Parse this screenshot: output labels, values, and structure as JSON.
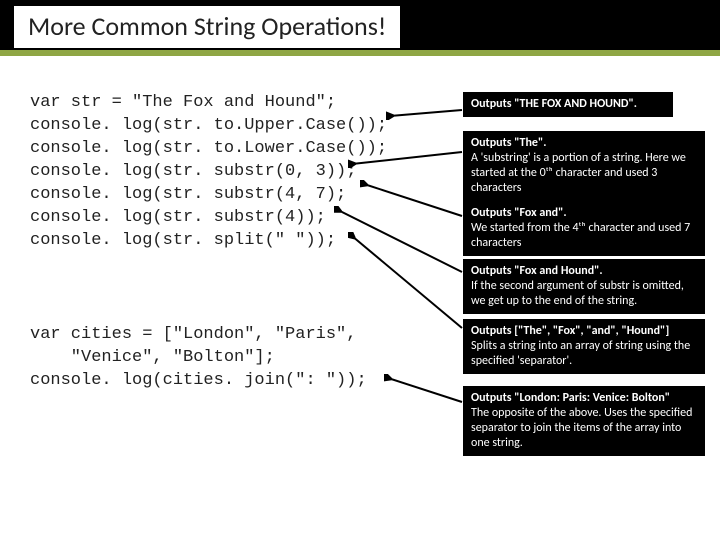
{
  "title": "More Common String Operations!",
  "code1": "var str = \"The Fox and Hound\";\nconsole. log(str. to.Upper.Case());\nconsole. log(str. to.Lower.Case());\nconsole. log(str. substr(0, 3));\nconsole. log(str. substr(4, 7);\nconsole. log(str. substr(4));\nconsole. log(str. split(\" \"));",
  "code2": "var cities = [\"London\", \"Paris\",\n    \"Venice\", \"Bolton\"];\nconsole. log(cities. join(\": \"));",
  "annos": {
    "a1": {
      "head": "Outputs \"THE FOX AND HOUND\"."
    },
    "a2": {
      "head": "Outputs \"The\".",
      "body": "A 'substring' is a portion of a string. Here we started at the 0ᵗʰ character and used 3 characters"
    },
    "a3": {
      "head": "Outputs \"Fox and\".",
      "body": "We started from the 4ᵗʰ character and used 7 characters"
    },
    "a4": {
      "head": "Outputs \"Fox and Hound\".",
      "body": "If the second argument of substr is omitted, we get up to the end of the string."
    },
    "a5": {
      "head": "Outputs [\"The\", \"Fox\", \"and\", \"Hound\"]",
      "body": "Splits a string into an array of string using the specified 'separator'."
    },
    "a6": {
      "head": "Outputs \"London: Paris: Venice: Bolton\"",
      "body": "The opposite of the above. Uses the specified separator to join the items of the array into one string."
    }
  }
}
